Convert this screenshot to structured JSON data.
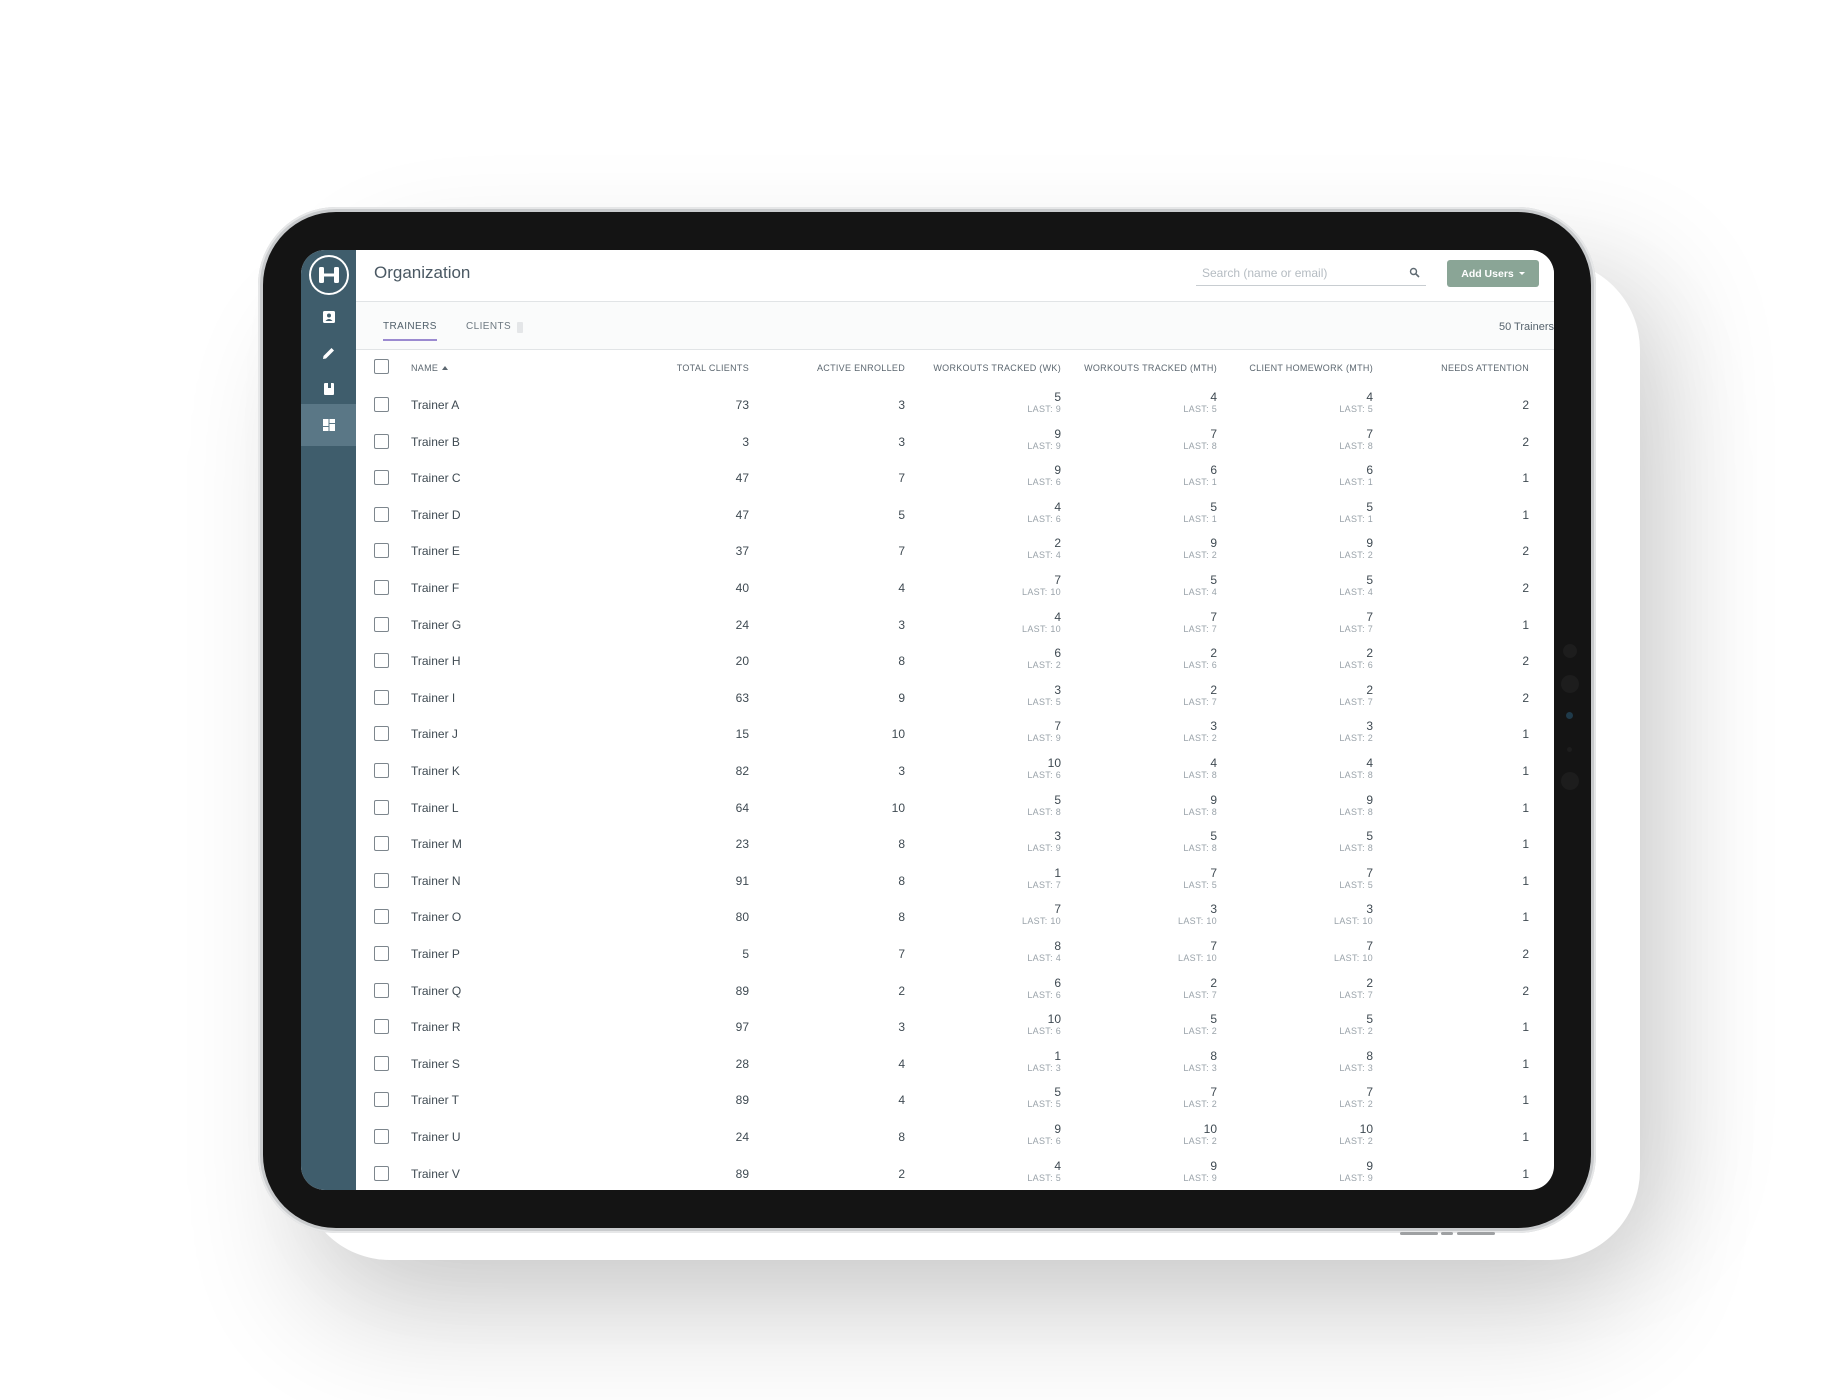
{
  "app": {
    "page_title": "Organization",
    "search_placeholder": "Search (name or email)",
    "add_users_label": "Add Users"
  },
  "sidebar": {
    "items": [
      {
        "icon": "contacts-icon"
      },
      {
        "icon": "pencil-icon"
      },
      {
        "icon": "book-icon"
      },
      {
        "icon": "dashboard-icon",
        "active": true
      }
    ]
  },
  "tabs": [
    {
      "label": "TRAINERS",
      "active": true
    },
    {
      "label": "CLIENTS",
      "active": false
    }
  ],
  "trainer_count": "50 Trainers",
  "columns": [
    "NAME",
    "TOTAL CLIENTS",
    "ACTIVE ENROLLED",
    "WORKOUTS TRACKED (WK)",
    "WORKOUTS TRACKED (MTH)",
    "CLIENT HOMEWORK (MTH)",
    "NEEDS ATTENTION"
  ],
  "last_prefix": "LAST:",
  "rows": [
    {
      "name": "Trainer A",
      "total": "73",
      "active": "3",
      "wk": "5",
      "wk_last": "9",
      "mth": "4",
      "mth_last": "5",
      "hw": "4",
      "hw_last": "5",
      "attn": "2"
    },
    {
      "name": "Trainer B",
      "total": "3",
      "active": "3",
      "wk": "9",
      "wk_last": "9",
      "mth": "7",
      "mth_last": "8",
      "hw": "7",
      "hw_last": "8",
      "attn": "2"
    },
    {
      "name": "Trainer C",
      "total": "47",
      "active": "7",
      "wk": "9",
      "wk_last": "6",
      "mth": "6",
      "mth_last": "1",
      "hw": "6",
      "hw_last": "1",
      "attn": "1"
    },
    {
      "name": "Trainer D",
      "total": "47",
      "active": "5",
      "wk": "4",
      "wk_last": "6",
      "mth": "5",
      "mth_last": "1",
      "hw": "5",
      "hw_last": "1",
      "attn": "1"
    },
    {
      "name": "Trainer E",
      "total": "37",
      "active": "7",
      "wk": "2",
      "wk_last": "4",
      "mth": "9",
      "mth_last": "2",
      "hw": "9",
      "hw_last": "2",
      "attn": "2"
    },
    {
      "name": "Trainer F",
      "total": "40",
      "active": "4",
      "wk": "7",
      "wk_last": "10",
      "mth": "5",
      "mth_last": "4",
      "hw": "5",
      "hw_last": "4",
      "attn": "2"
    },
    {
      "name": "Trainer G",
      "total": "24",
      "active": "3",
      "wk": "4",
      "wk_last": "10",
      "mth": "7",
      "mth_last": "7",
      "hw": "7",
      "hw_last": "7",
      "attn": "1"
    },
    {
      "name": "Trainer H",
      "total": "20",
      "active": "8",
      "wk": "6",
      "wk_last": "2",
      "mth": "2",
      "mth_last": "6",
      "hw": "2",
      "hw_last": "6",
      "attn": "2"
    },
    {
      "name": "Trainer I",
      "total": "63",
      "active": "9",
      "wk": "3",
      "wk_last": "5",
      "mth": "2",
      "mth_last": "7",
      "hw": "2",
      "hw_last": "7",
      "attn": "2"
    },
    {
      "name": "Trainer J",
      "total": "15",
      "active": "10",
      "wk": "7",
      "wk_last": "9",
      "mth": "3",
      "mth_last": "2",
      "hw": "3",
      "hw_last": "2",
      "attn": "1"
    },
    {
      "name": "Trainer K",
      "total": "82",
      "active": "3",
      "wk": "10",
      "wk_last": "6",
      "mth": "4",
      "mth_last": "8",
      "hw": "4",
      "hw_last": "8",
      "attn": "1"
    },
    {
      "name": "Trainer L",
      "total": "64",
      "active": "10",
      "wk": "5",
      "wk_last": "8",
      "mth": "9",
      "mth_last": "8",
      "hw": "9",
      "hw_last": "8",
      "attn": "1"
    },
    {
      "name": "Trainer M",
      "total": "23",
      "active": "8",
      "wk": "3",
      "wk_last": "9",
      "mth": "5",
      "mth_last": "8",
      "hw": "5",
      "hw_last": "8",
      "attn": "1"
    },
    {
      "name": "Trainer N",
      "total": "91",
      "active": "8",
      "wk": "1",
      "wk_last": "7",
      "mth": "7",
      "mth_last": "5",
      "hw": "7",
      "hw_last": "5",
      "attn": "1"
    },
    {
      "name": "Trainer O",
      "total": "80",
      "active": "8",
      "wk": "7",
      "wk_last": "10",
      "mth": "3",
      "mth_last": "10",
      "hw": "3",
      "hw_last": "10",
      "attn": "1"
    },
    {
      "name": "Trainer P",
      "total": "5",
      "active": "7",
      "wk": "8",
      "wk_last": "4",
      "mth": "7",
      "mth_last": "10",
      "hw": "7",
      "hw_last": "10",
      "attn": "2"
    },
    {
      "name": "Trainer Q",
      "total": "89",
      "active": "2",
      "wk": "6",
      "wk_last": "6",
      "mth": "2",
      "mth_last": "7",
      "hw": "2",
      "hw_last": "7",
      "attn": "2"
    },
    {
      "name": "Trainer R",
      "total": "97",
      "active": "3",
      "wk": "10",
      "wk_last": "6",
      "mth": "5",
      "mth_last": "2",
      "hw": "5",
      "hw_last": "2",
      "attn": "1"
    },
    {
      "name": "Trainer S",
      "total": "28",
      "active": "4",
      "wk": "1",
      "wk_last": "3",
      "mth": "8",
      "mth_last": "3",
      "hw": "8",
      "hw_last": "3",
      "attn": "1"
    },
    {
      "name": "Trainer T",
      "total": "89",
      "active": "4",
      "wk": "5",
      "wk_last": "5",
      "mth": "7",
      "mth_last": "2",
      "hw": "7",
      "hw_last": "2",
      "attn": "1"
    },
    {
      "name": "Trainer U",
      "total": "24",
      "active": "8",
      "wk": "9",
      "wk_last": "6",
      "mth": "10",
      "mth_last": "2",
      "hw": "10",
      "hw_last": "2",
      "attn": "1"
    },
    {
      "name": "Trainer V",
      "total": "89",
      "active": "2",
      "wk": "4",
      "wk_last": "5",
      "mth": "9",
      "mth_last": "9",
      "hw": "9",
      "hw_last": "9",
      "attn": "1"
    }
  ],
  "colors": {
    "sidebar": "#3f5d6c",
    "sidebar_active": "#5a7786",
    "accent_button": "#8aa596",
    "tab_underline": "#9b8ad0"
  }
}
